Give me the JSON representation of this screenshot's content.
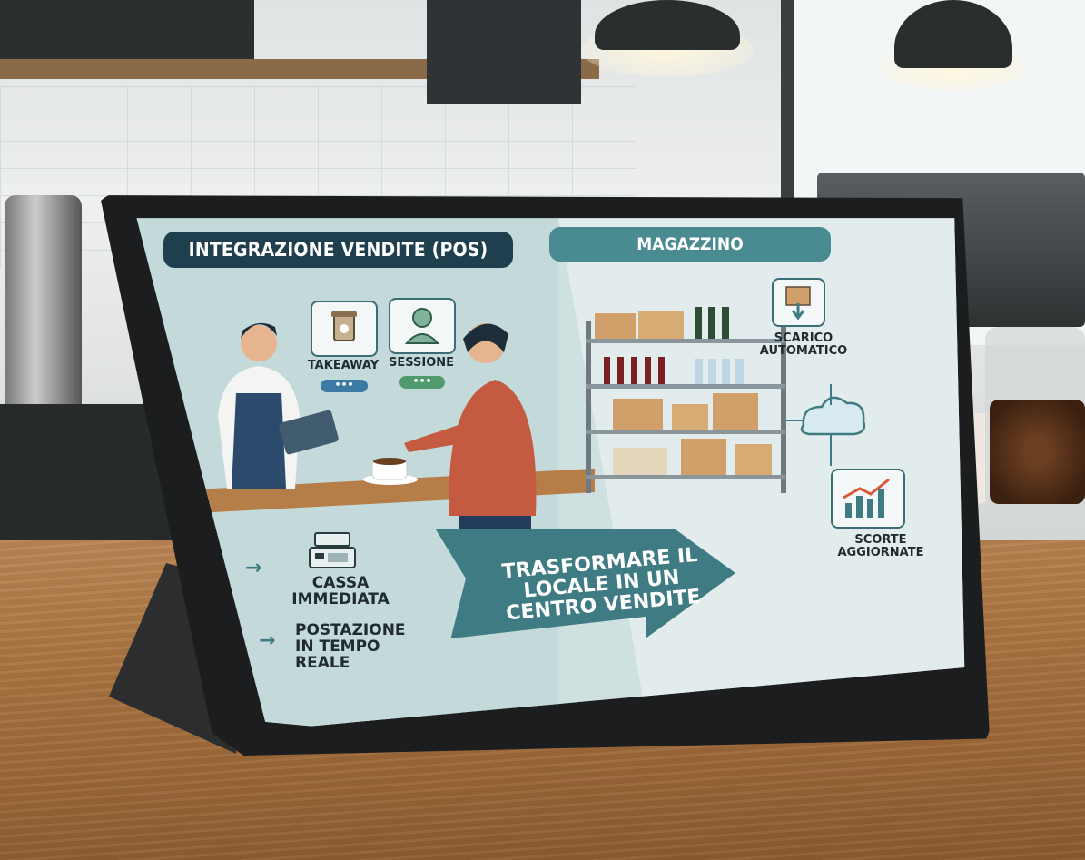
{
  "tablet": {
    "left_panel": {
      "title": "INTEGRAZIONE VENDITE (POS)",
      "chip_takeaway": "TAKEAWAY",
      "chip_sessione": "SESSIONE",
      "chip_dots": "•••",
      "feature_1": "CASSA IMMEDIATA",
      "feature_2": "POSTAZIONE IN TEMPO REALE"
    },
    "right_panel": {
      "title": "MAGAZZINO",
      "label_scarico": "SCARICO AUTOMATICO",
      "label_scorte": "SCORTE AGGIORNATE"
    },
    "banner": "TRASFORMARE IL LOCALE IN UN CENTRO VENDITE"
  },
  "colors": {
    "navy": "#203f4e",
    "teal": "#4a8a91",
    "arrow_teal": "#3f7b82",
    "dots_blue": "#3b7aa3",
    "dots_green": "#4f9b6e"
  },
  "icons": [
    "coffee-cup-icon",
    "user-icon",
    "box-download-icon",
    "cloud-icon",
    "chart-up-icon",
    "cash-register-icon"
  ]
}
